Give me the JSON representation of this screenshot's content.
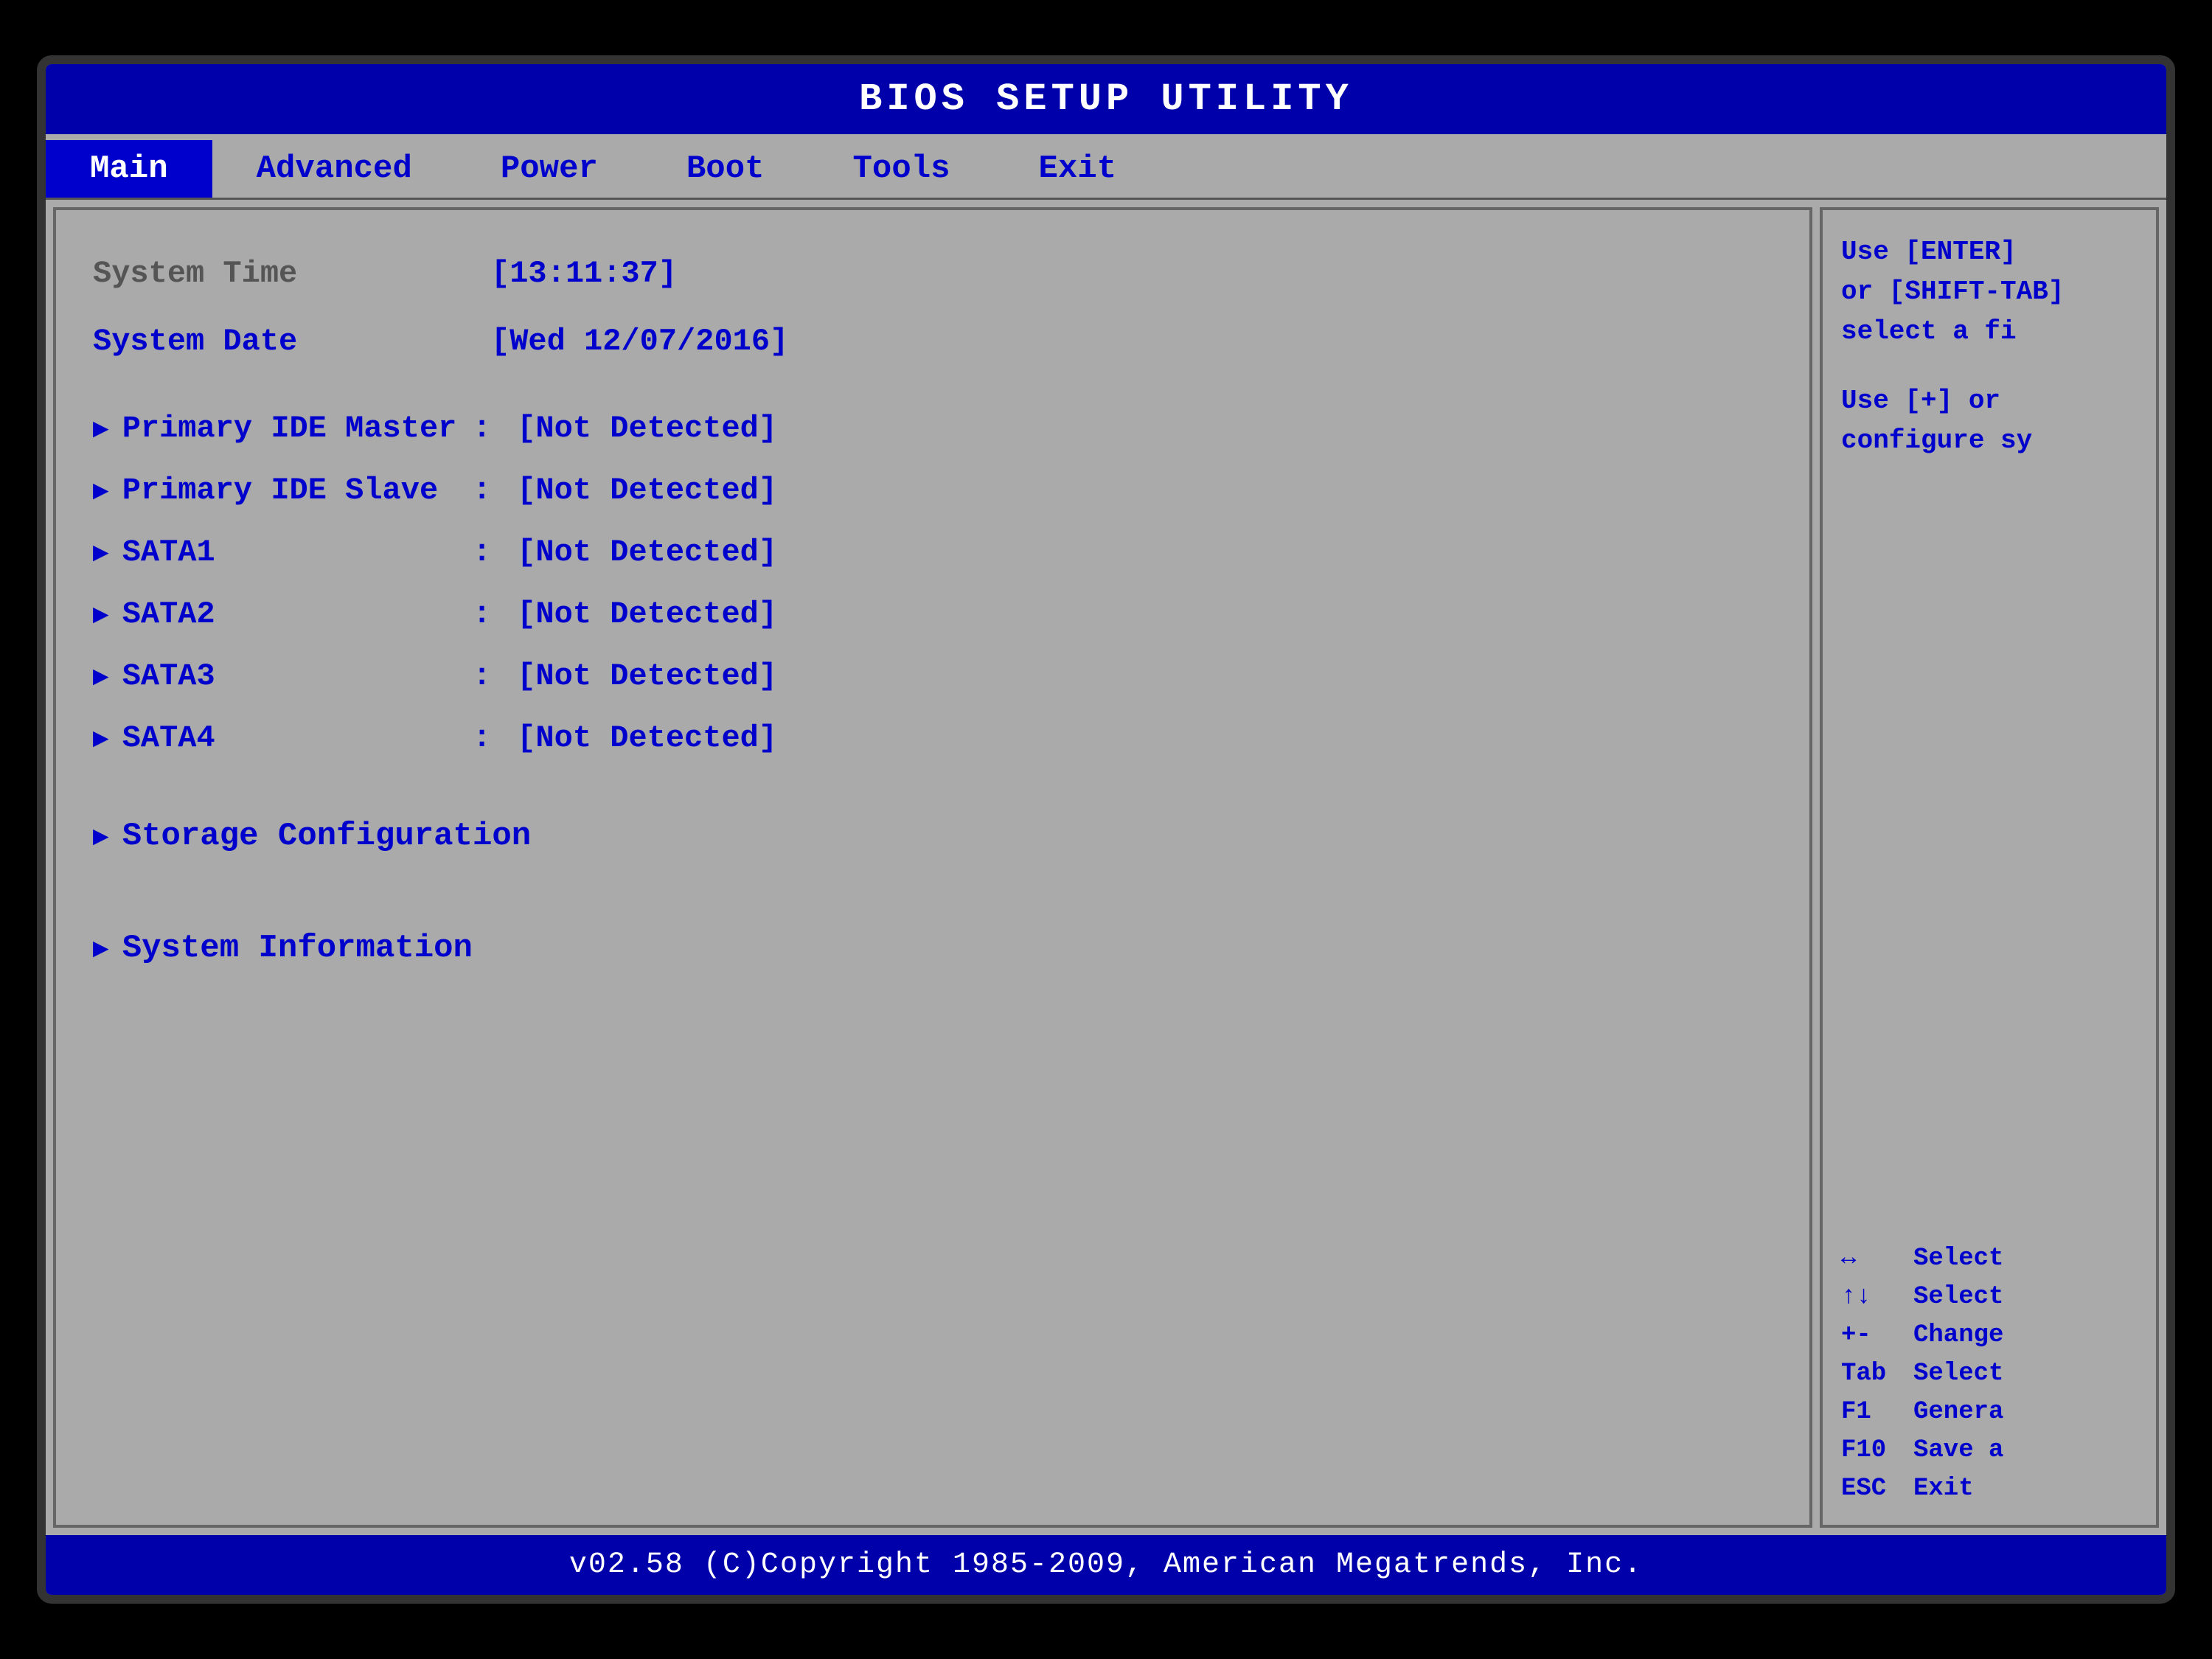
{
  "title": "BIOS  SETUP  UTILITY",
  "nav": {
    "items": [
      {
        "label": "Main",
        "active": true
      },
      {
        "label": "Advanced",
        "active": false
      },
      {
        "label": "Power",
        "active": false
      },
      {
        "label": "Boot",
        "active": false
      },
      {
        "label": "Tools",
        "active": false
      },
      {
        "label": "Exit",
        "active": false
      }
    ]
  },
  "main": {
    "system_time_label": "System Time",
    "system_time_value": "[13:11:37]",
    "system_date_label": "System Date",
    "system_date_value": "[Wed 12/07/2016]",
    "devices": [
      {
        "label": "Primary IDE Master",
        "value": "[Not Detected]"
      },
      {
        "label": "Primary IDE Slave",
        "value": "[Not Detected]"
      },
      {
        "label": "SATA1",
        "value": "[Not Detected]"
      },
      {
        "label": "SATA2",
        "value": "[Not Detected]"
      },
      {
        "label": "SATA3",
        "value": "[Not Detected]"
      },
      {
        "label": "SATA4",
        "value": "[Not Detected]"
      }
    ],
    "sections": [
      {
        "label": "Storage Configuration"
      },
      {
        "label": "System Information"
      }
    ]
  },
  "help": {
    "text1": "Use [ENTER]",
    "text2": "or [SHIFT-TAB]",
    "text3": "select a fi",
    "text4": "Use [+] or",
    "text5": "configure sy"
  },
  "keys": [
    {
      "symbol": "↔",
      "desc": "Select"
    },
    {
      "symbol": "↑↓",
      "desc": "Select"
    },
    {
      "symbol": "+-",
      "desc": "Change"
    },
    {
      "symbol": "Tab",
      "desc": "Select"
    },
    {
      "symbol": "F1",
      "desc": "Genera"
    },
    {
      "symbol": "F10",
      "desc": "Save a"
    },
    {
      "symbol": "ESC",
      "desc": "Exit"
    }
  ],
  "footer": "v02.58  (C)Copyright 1985-2009, American Megatrends, Inc."
}
